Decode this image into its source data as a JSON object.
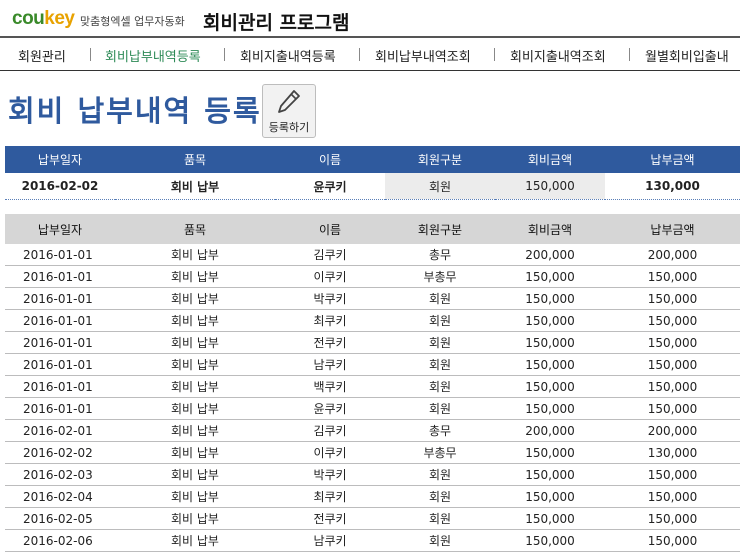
{
  "brand": {
    "logo_part1": "cou",
    "logo_part2": "key",
    "tagline": "맞춤형엑셀 업무자동화"
  },
  "app_title": "회비관리 프로그램",
  "nav": [
    {
      "label": "회원관리"
    },
    {
      "label": "회비납부내역등록"
    },
    {
      "label": "회비지출내역등록"
    },
    {
      "label": "회비납부내역조회"
    },
    {
      "label": "회비지출내역조회"
    },
    {
      "label": "월별회비입출내"
    }
  ],
  "page_title": "회비 납부내역 등록",
  "register_button": {
    "label": "등록하기",
    "icon": "pencil-icon"
  },
  "columns": [
    "납부일자",
    "품목",
    "이름",
    "회원구분",
    "회비금액",
    "납부금액"
  ],
  "entry": {
    "date": "2016-02-02",
    "item": "회비 납부",
    "name": "윤쿠키",
    "type": "회원",
    "fee": "150,000",
    "paid": "130,000"
  },
  "records": [
    [
      "2016-01-01",
      "회비 납부",
      "김쿠키",
      "총무",
      "200,000",
      "200,000"
    ],
    [
      "2016-01-01",
      "회비 납부",
      "이쿠키",
      "부총무",
      "150,000",
      "150,000"
    ],
    [
      "2016-01-01",
      "회비 납부",
      "박쿠키",
      "회원",
      "150,000",
      "150,000"
    ],
    [
      "2016-01-01",
      "회비 납부",
      "최쿠키",
      "회원",
      "150,000",
      "150,000"
    ],
    [
      "2016-01-01",
      "회비 납부",
      "전쿠키",
      "회원",
      "150,000",
      "150,000"
    ],
    [
      "2016-01-01",
      "회비 납부",
      "남쿠키",
      "회원",
      "150,000",
      "150,000"
    ],
    [
      "2016-01-01",
      "회비 납부",
      "백쿠키",
      "회원",
      "150,000",
      "150,000"
    ],
    [
      "2016-01-01",
      "회비 납부",
      "윤쿠키",
      "회원",
      "150,000",
      "150,000"
    ],
    [
      "2016-02-01",
      "회비 납부",
      "김쿠키",
      "총무",
      "200,000",
      "200,000"
    ],
    [
      "2016-02-02",
      "회비 납부",
      "이쿠키",
      "부총무",
      "150,000",
      "130,000"
    ],
    [
      "2016-02-03",
      "회비 납부",
      "박쿠키",
      "회원",
      "150,000",
      "150,000"
    ],
    [
      "2016-02-04",
      "회비 납부",
      "최쿠키",
      "회원",
      "150,000",
      "150,000"
    ],
    [
      "2016-02-05",
      "회비 납부",
      "전쿠키",
      "회원",
      "150,000",
      "150,000"
    ],
    [
      "2016-02-06",
      "회비 납부",
      "남쿠키",
      "회원",
      "150,000",
      "150,000"
    ]
  ],
  "colors": {
    "header_blue": "#2f5a9e",
    "active_nav": "#2e8b57",
    "list_header": "#d6d6d6"
  }
}
